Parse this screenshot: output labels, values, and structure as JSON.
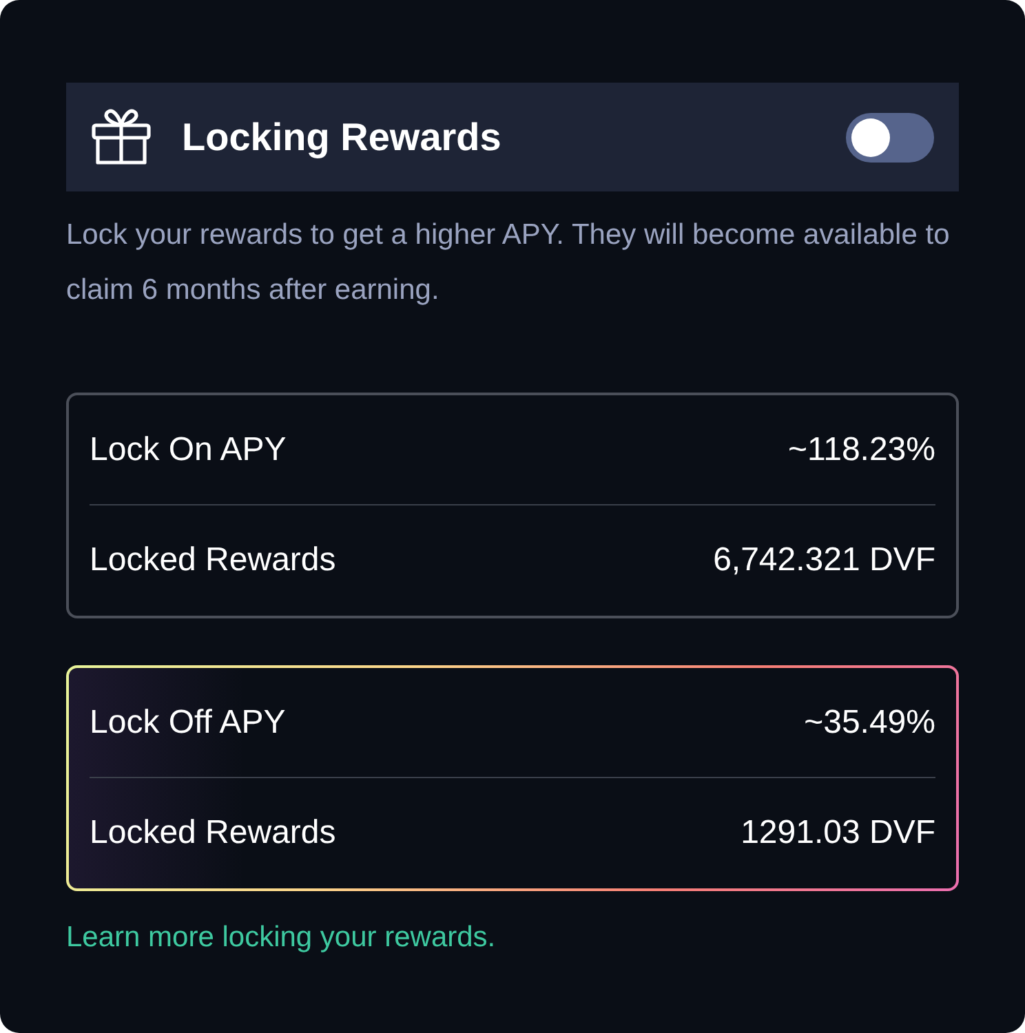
{
  "header": {
    "title": "Locking Rewards",
    "toggle": {
      "on": false
    }
  },
  "description": "Lock your rewards to get a higher APY. They will become available to claim 6 months after earning.",
  "cards": [
    {
      "selected": false,
      "rows": [
        {
          "label": "Lock On APY",
          "value": "~118.23%"
        },
        {
          "label": "Locked Rewards",
          "value": "6,742.321 DVF"
        }
      ]
    },
    {
      "selected": true,
      "rows": [
        {
          "label": "Lock Off APY",
          "value": "~35.49%"
        },
        {
          "label": "Locked Rewards",
          "value": "1291.03 DVF"
        }
      ]
    }
  ],
  "link": "Learn more locking your rewards."
}
